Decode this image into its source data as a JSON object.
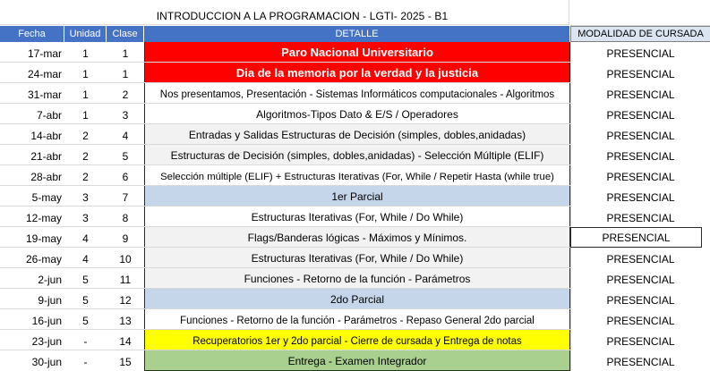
{
  "sheet": {
    "title": "INTRODUCCION A LA PROGRAMACION - LGTI- 2025 - B1",
    "headers": {
      "fecha": "Fecha",
      "unidad": "Unidad",
      "clase": "Clase",
      "detalle": "DETALLE",
      "modalidad": "MODALIDAD DE CURSADA"
    },
    "colors": {
      "header_blue": "#4472c4",
      "red": "#ff0000",
      "parcial_blue": "#c5d5ea",
      "yellow": "#ffff00",
      "green": "#a9d08e",
      "grey": "#f2f2f2"
    },
    "rows": [
      {
        "fecha": "17-mar",
        "unidad": "1",
        "clase": "1",
        "detalle": "Paro Nacional Universitario",
        "modalidad": "PRESENCIAL"
      },
      {
        "fecha": "24-mar",
        "unidad": "1",
        "clase": "1",
        "detalle": "Dia de la memoria por la verdad y la justicia",
        "modalidad": "PRESENCIAL"
      },
      {
        "fecha": "31-mar",
        "unidad": "1",
        "clase": "2",
        "detalle": "Nos presentamos, Presentación - Sistemas Informáticos computacionales - Algoritmos",
        "modalidad": "PRESENCIAL"
      },
      {
        "fecha": "7-abr",
        "unidad": "1",
        "clase": "3",
        "detalle": "Algoritmos-Tipos Dato & E/S / Operadores",
        "modalidad": "PRESENCIAL"
      },
      {
        "fecha": "14-abr",
        "unidad": "2",
        "clase": "4",
        "detalle": "Entradas y Salidas Estructuras de Decisión (simples, dobles,anidadas)",
        "modalidad": "PRESENCIAL"
      },
      {
        "fecha": "21-abr",
        "unidad": "2",
        "clase": "5",
        "detalle": "Estructuras de Decisión (simples, dobles,anidadas) - Selección Múltiple (ELIF)",
        "modalidad": "PRESENCIAL"
      },
      {
        "fecha": "28-abr",
        "unidad": "2",
        "clase": "6",
        "detalle": "Selección múltiple (ELIF) + Estructuras Iterativas (For, While / Repetir Hasta (while true)",
        "modalidad": "PRESENCIAL"
      },
      {
        "fecha": "5-may",
        "unidad": "3",
        "clase": "7",
        "detalle": "1er Parcial",
        "modalidad": "PRESENCIAL"
      },
      {
        "fecha": "12-may",
        "unidad": "3",
        "clase": "8",
        "detalle": "Estructuras Iterativas (For, While / Do While)",
        "modalidad": "PRESENCIAL"
      },
      {
        "fecha": "19-may",
        "unidad": "4",
        "clase": "9",
        "detalle": "Flags/Banderas lógicas - Máximos y Mínimos.",
        "modalidad": "PRESENCIAL"
      },
      {
        "fecha": "26-may",
        "unidad": "4",
        "clase": "10",
        "detalle": "Estructuras Iterativas (For, While / Do While)",
        "modalidad": "PRESENCIAL"
      },
      {
        "fecha": "2-jun",
        "unidad": "5",
        "clase": "11",
        "detalle": "Funciones - Retorno de la función - Parámetros",
        "modalidad": "PRESENCIAL"
      },
      {
        "fecha": "9-jun",
        "unidad": "5",
        "clase": "12",
        "detalle": "2do Parcial",
        "modalidad": "PRESENCIAL"
      },
      {
        "fecha": "16-jun",
        "unidad": "5",
        "clase": "13",
        "detalle": "Funciones - Retorno de la función - Parámetros - Repaso General 2do parcial",
        "modalidad": "PRESENCIAL"
      },
      {
        "fecha": "23-jun",
        "unidad": "-",
        "clase": "14",
        "detalle": "Recuperatorios 1er y 2do parcial - Cierre de cursada y Entrega de notas",
        "modalidad": "PRESENCIAL"
      },
      {
        "fecha": "30-jun",
        "unidad": "-",
        "clase": "15",
        "detalle": "Entrega - Examen Integrador",
        "modalidad": "PRESENCIAL"
      }
    ]
  }
}
